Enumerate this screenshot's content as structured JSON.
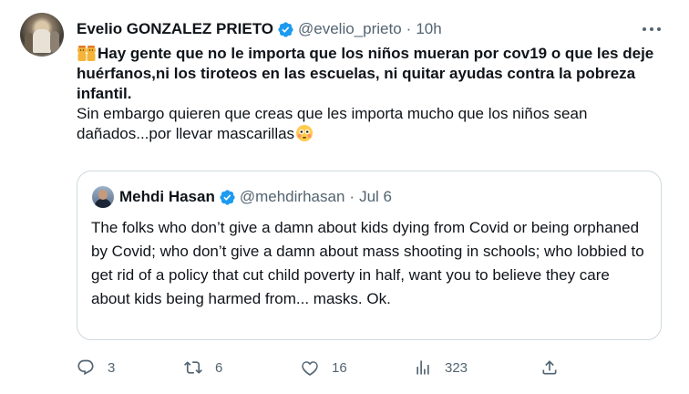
{
  "tweet": {
    "author_name": "Evelio GONZALEZ PRIETO",
    "author_handle": "@evelio_prieto",
    "separator": "·",
    "time": "10h",
    "icons": {
      "verified": "verified-badge-icon",
      "more": "more-options-icon",
      "kids_emoji": "children-emoji-icon",
      "flushed_emoji": "flushed-face-emoji-icon"
    },
    "text_bold": "Hay gente que no le importa que los niños mueran por cov19 o que les deje huérfanos,ni los tiroteos en las escuelas, ni quitar ayudas contra la pobreza infantil.",
    "text_normal": "Sin embargo quieren que creas que les importa mucho que los niños sean dañados...por llevar mascarillas",
    "accent_color": "#1d9bf0"
  },
  "quoted": {
    "author_name": "Mehdi Hasan",
    "author_handle": "@mehdirhasan",
    "separator": "·",
    "date": "Jul 6",
    "text": "The folks who don’t give a damn about kids dying from Covid or being orphaned by Covid; who don’t give a damn about mass shooting in schools; who lobbied to get rid of a policy that cut child poverty in half, want you to believe they care about kids being harmed from... masks. Ok."
  },
  "actions": {
    "reply_count": "3",
    "retweet_count": "6",
    "like_count": "16",
    "views_count": "323",
    "icons": [
      "reply-icon",
      "retweet-icon",
      "like-icon",
      "views-icon",
      "share-icon"
    ]
  }
}
